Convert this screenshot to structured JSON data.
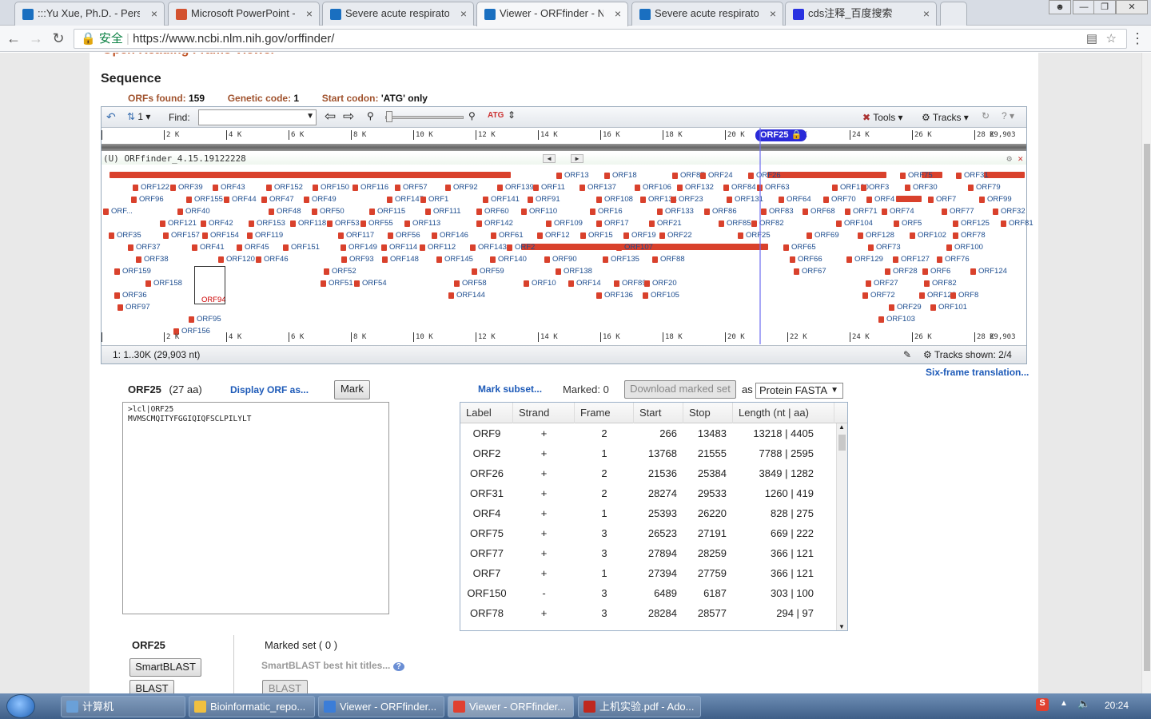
{
  "tabs": [
    {
      "label": ":::Yu Xue, Ph.D. - Person",
      "fav": "#1a6fc0"
    },
    {
      "label": "Microsoft PowerPoint -",
      "fav": "#d35230"
    },
    {
      "label": "Severe acute respirator",
      "fav": "#1a6fc0"
    },
    {
      "label": "Viewer - ORFfinder - N",
      "fav": "#1a6fc0"
    },
    {
      "label": "Severe acute respirator",
      "fav": "#1a6fc0"
    },
    {
      "label": "cds注释_百度搜索",
      "fav": "#2932e1"
    }
  ],
  "address": {
    "secure_label": "安全",
    "url": "https://www.ncbi.nlm.nih.gov/orffinder/"
  },
  "page": {
    "heading": "Open Reading Frame Viewer",
    "section": "Sequence",
    "stats": {
      "orfs_label": "ORFs found:",
      "orfs_value": "159",
      "code_label": "Genetic code:",
      "code_value": "1",
      "start_label": "Start codon:",
      "start_value": "'ATG' only"
    }
  },
  "viewer": {
    "find_label": "Find:",
    "page_num": "1",
    "tools_label": "Tools",
    "tracks_label": "Tracks",
    "ruler": [
      "2 K",
      "4 K",
      "6 K",
      "8 K",
      "10 K",
      "12 K",
      "14 K",
      "16 K",
      "18 K",
      "20 K",
      "22 K",
      "24 K",
      "26 K",
      "28 K",
      "29,903"
    ],
    "marker": "ORF25",
    "track_title": "(U) ORFfinder_4.15.19122228",
    "range": "1: 1..30K (29,903 nt)",
    "tracks_shown": "Tracks shown: 2/4",
    "six_frame": "Six-frame translation...",
    "rows": [
      [
        [
          "ORF13",
          705
        ],
        [
          "ORF18",
          765
        ],
        [
          "ORF87",
          850
        ],
        [
          "ORF24",
          885
        ],
        [
          "ORF26",
          945
        ],
        [
          "ORF75",
          1135
        ],
        [
          "ORF31",
          1205
        ]
      ],
      [
        [
          "ORF122",
          175
        ],
        [
          "ORF39",
          222
        ],
        [
          "ORF43",
          275
        ],
        [
          "ORF152",
          342
        ],
        [
          "ORF150",
          400
        ],
        [
          "ORF116",
          450
        ],
        [
          "ORF57",
          503
        ],
        [
          "ORF92",
          566
        ],
        [
          "ORF139",
          631
        ],
        [
          "ORF11",
          676
        ],
        [
          "ORF137",
          734
        ],
        [
          "ORF106",
          803
        ],
        [
          "ORF132",
          856
        ],
        [
          "ORF84",
          914
        ],
        [
          "ORF63",
          956
        ],
        [
          "ORF130",
          1050
        ],
        [
          "ORF3",
          1086
        ],
        [
          "ORF30",
          1141
        ],
        [
          "ORF79",
          1220
        ]
      ],
      [
        [
          "ORF96",
          173
        ],
        [
          "ORF155",
          242
        ],
        [
          "ORF44",
          289
        ],
        [
          "ORF47",
          336
        ],
        [
          "ORF49",
          389
        ],
        [
          "ORF147",
          493
        ],
        [
          "ORF1",
          535
        ],
        [
          "ORF141",
          613
        ],
        [
          "ORF91",
          669
        ],
        [
          "ORF108",
          755
        ],
        [
          "ORF134",
          810
        ],
        [
          "ORF23",
          848
        ],
        [
          "ORF131",
          918
        ],
        [
          "ORF64",
          983
        ],
        [
          "ORF70",
          1039
        ],
        [
          "ORF4",
          1093
        ],
        [
          "ORF7",
          1170
        ],
        [
          "ORF99",
          1234
        ]
      ],
      [
        [
          "ORF...",
          138
        ],
        [
          "ORF40",
          231
        ],
        [
          "ORF48",
          345
        ],
        [
          "ORF50",
          399
        ],
        [
          "ORF115",
          471
        ],
        [
          "ORF111",
          541
        ],
        [
          "ORF60",
          605
        ],
        [
          "ORF110",
          661
        ],
        [
          "ORF16",
          747
        ],
        [
          "ORF133",
          831
        ],
        [
          "ORF86",
          890
        ],
        [
          "ORF83",
          961
        ],
        [
          "ORF68",
          1013
        ],
        [
          "ORF71",
          1066
        ],
        [
          "ORF74",
          1112
        ],
        [
          "ORF77",
          1187
        ],
        [
          "ORF32",
          1251
        ]
      ],
      [
        [
          "ORF121",
          209
        ],
        [
          "ORF42",
          260
        ],
        [
          "ORF153",
          320
        ],
        [
          "ORF118",
          372
        ],
        [
          "ORF53",
          418
        ],
        [
          "ORF55",
          460
        ],
        [
          "ORF113",
          515
        ],
        [
          "ORF142",
          605
        ],
        [
          "ORF109",
          692
        ],
        [
          "ORF17",
          755
        ],
        [
          "ORF21",
          821
        ],
        [
          "ORF85",
          908
        ],
        [
          "ORF82",
          949
        ],
        [
          "ORF104",
          1055
        ],
        [
          "ORF5",
          1127
        ],
        [
          "ORF125",
          1201
        ],
        [
          "ORF81",
          1261
        ]
      ],
      [
        [
          "ORF35",
          145
        ],
        [
          "ORF157",
          213
        ],
        [
          "ORF154",
          262
        ],
        [
          "ORF119",
          318
        ],
        [
          "ORF117",
          432
        ],
        [
          "ORF56",
          494
        ],
        [
          "ORF146",
          549
        ],
        [
          "ORF61",
          623
        ],
        [
          "ORF12",
          681
        ],
        [
          "ORF15",
          735
        ],
        [
          "ORF19",
          789
        ],
        [
          "ORF22",
          834
        ],
        [
          "ORF25",
          932
        ],
        [
          "ORF69",
          1018
        ],
        [
          "ORF128",
          1082
        ],
        [
          "ORF102",
          1147
        ],
        [
          "ORF78",
          1201
        ]
      ],
      [
        [
          "ORF37",
          169
        ],
        [
          "ORF41",
          249
        ],
        [
          "ORF45",
          305
        ],
        [
          "ORF151",
          363
        ],
        [
          "ORF149",
          435
        ],
        [
          "ORF114",
          486
        ],
        [
          "ORF112",
          534
        ],
        [
          "ORF143",
          597
        ],
        [
          "ORF2",
          643
        ],
        [
          "ORF107",
          780
        ],
        [
          "ORF65",
          989
        ],
        [
          "ORF73",
          1095
        ],
        [
          "ORF100",
          1193
        ]
      ],
      [
        [
          "ORF38",
          179
        ],
        [
          "ORF120",
          282
        ],
        [
          "ORF46",
          329
        ],
        [
          "ORF93",
          436
        ],
        [
          "ORF148",
          487
        ],
        [
          "ORF145",
          555
        ],
        [
          "ORF140",
          622
        ],
        [
          "ORF90",
          690
        ],
        [
          "ORF135",
          763
        ],
        [
          "ORF88",
          825
        ],
        [
          "ORF66",
          997
        ],
        [
          "ORF129",
          1068
        ],
        [
          "ORF127",
          1126
        ],
        [
          "ORF76",
          1181
        ]
      ],
      [
        [
          "ORF159",
          152
        ],
        [
          "ORF52",
          414
        ],
        [
          "ORF59",
          599
        ],
        [
          "ORF138",
          704
        ],
        [
          "ORF67",
          1002
        ],
        [
          "ORF28",
          1116
        ],
        [
          "ORF6",
          1163
        ],
        [
          "ORF124",
          1223
        ]
      ],
      [
        [
          "ORF158",
          191
        ],
        [
          "ORF51",
          410
        ],
        [
          "ORF54",
          452
        ],
        [
          "ORF58",
          577
        ],
        [
          "ORF10",
          664
        ],
        [
          "ORF14",
          720
        ],
        [
          "ORF89",
          777
        ],
        [
          "ORF20",
          815
        ],
        [
          "ORF27",
          1092
        ],
        [
          "ORF82",
          1165
        ]
      ],
      [
        [
          "ORF36",
          152
        ],
        [
          "ORF144",
          570
        ],
        [
          "ORF136",
          755
        ],
        [
          "ORF105",
          813
        ],
        [
          "ORF72",
          1088
        ],
        [
          "ORF126",
          1159
        ],
        [
          "ORF8",
          1198
        ]
      ],
      [
        [
          "ORF97",
          156
        ],
        [
          "ORF29",
          1121
        ],
        [
          "ORF101",
          1173
        ]
      ],
      [
        [
          "ORF95",
          245
        ],
        [
          "ORF103",
          1108
        ]
      ],
      [
        [
          "ORF156",
          226
        ]
      ]
    ]
  },
  "detail": {
    "orf": "ORF25",
    "aa": "(27 aa)",
    "display_as": "Display ORF as...",
    "mark": "Mark",
    "fasta_header": ">lcl|ORF25",
    "fasta_seq": "MVMSCMQITYFGGIQIQFSCLPILYLT"
  },
  "subset": {
    "mark_subset": "Mark subset...",
    "marked": "Marked: 0",
    "download": "Download marked set",
    "as": "as",
    "format": "Protein FASTA"
  },
  "table": {
    "headers": [
      "Label",
      "Strand",
      "Frame",
      "Start",
      "Stop",
      "Length (nt | aa)"
    ],
    "rows": [
      [
        "ORF9",
        "+",
        "2",
        "266",
        "13483",
        "13218 | 4405"
      ],
      [
        "ORF2",
        "+",
        "1",
        "13768",
        "21555",
        "7788 | 2595"
      ],
      [
        "ORF26",
        "+",
        "2",
        "21536",
        "25384",
        "3849 | 1282"
      ],
      [
        "ORF31",
        "+",
        "2",
        "28274",
        "29533",
        "1260 | 419"
      ],
      [
        "ORF4",
        "+",
        "1",
        "25393",
        "26220",
        "828 | 275"
      ],
      [
        "ORF75",
        "+",
        "3",
        "26523",
        "27191",
        "669 | 222"
      ],
      [
        "ORF77",
        "+",
        "3",
        "27894",
        "28259",
        "366 | 121"
      ],
      [
        "ORF7",
        "+",
        "1",
        "27394",
        "27759",
        "366 | 121"
      ],
      [
        "ORF150",
        "-",
        "3",
        "6489",
        "6187",
        "303 | 100"
      ],
      [
        "ORF78",
        "+",
        "3",
        "28284",
        "28577",
        "294 | 97"
      ]
    ]
  },
  "bottom": {
    "orf": "ORF25",
    "smartblast": "SmartBLAST",
    "blast": "BLAST",
    "marked_set": "Marked set ( 0 )",
    "best_hits": "SmartBLAST best hit titles...",
    "blast2": "BLAST"
  },
  "taskbar": [
    {
      "label": "计算机",
      "color": "#6aa0d8"
    },
    {
      "label": "Bioinformatic_repo...",
      "color": "#f0c040"
    },
    {
      "label": "Viewer - ORFfinder...",
      "color": "#3b7dd8"
    },
    {
      "label": "Viewer - ORFfinder...",
      "color": "#e04030"
    },
    {
      "label": "上机实验.pdf - Ado...",
      "color": "#c0281e"
    }
  ],
  "clock": "20:24"
}
